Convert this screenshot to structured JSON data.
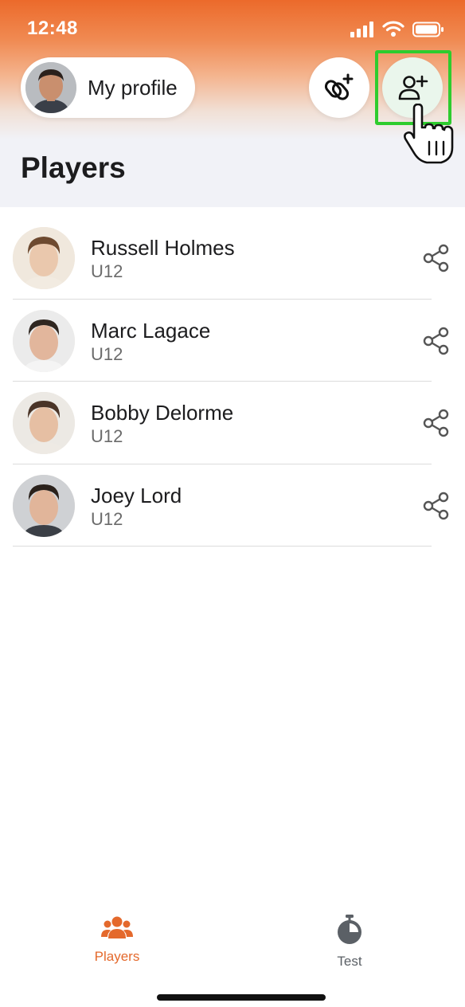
{
  "status_bar": {
    "time": "12:48"
  },
  "header": {
    "profile_label": "My profile",
    "title": "Players"
  },
  "players": [
    {
      "name": "Russell Holmes",
      "team": "U12"
    },
    {
      "name": "Marc Lagace",
      "team": "U12"
    },
    {
      "name": "Bobby Delorme",
      "team": "U12"
    },
    {
      "name": "Joey Lord",
      "team": "U12"
    }
  ],
  "tabs": [
    {
      "label": "Players",
      "active": true,
      "icon": "team-icon"
    },
    {
      "label": "Test",
      "active": false,
      "icon": "stopwatch-icon"
    }
  ],
  "colors": {
    "accent": "#e4692c",
    "highlight": "#2ecc2e",
    "header_bg": "#f1f2f7"
  }
}
